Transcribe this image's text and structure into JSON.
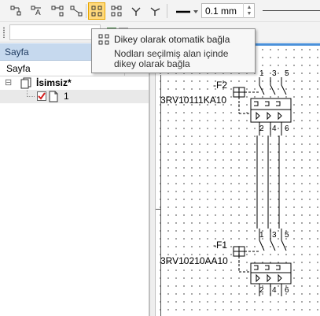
{
  "toolbar": {
    "line_width_value": "0.1 mm",
    "buttons": [
      "connect-icon",
      "text-connect-icon",
      "horizontal-connect-icon",
      "diagonal-connect-icon",
      "vertical-auto-connect-icon",
      "grid-connect-icon",
      "branch-icon",
      "branch-right-icon",
      "line-style-icon"
    ]
  },
  "tooltip": {
    "title": "Dikey olarak otomatik bağla",
    "description": "Nodları seçilmiş alan içinde dikey olarak bağla"
  },
  "left_pane": {
    "title": "Sayfa",
    "column_header": "Sayfa",
    "tree": [
      {
        "label": "İsimsiz*",
        "expand": "⊟"
      },
      {
        "label": "1"
      }
    ]
  },
  "schematic": {
    "component1": {
      "tag": "-F2",
      "part": "3RV10111KA10",
      "top_pins": [
        "1",
        "3",
        "5"
      ],
      "bottom_pins": [
        "2",
        "4",
        "6"
      ]
    },
    "component2": {
      "tag": "-F1",
      "part": "3RV10210AA10",
      "top_pins": [
        "1",
        "3",
        "5"
      ],
      "bottom_pins": [
        "2",
        "4",
        "6"
      ]
    }
  },
  "colors": {
    "accent": "#4a90d9",
    "active_button": "#ffd97a",
    "pane_title_bg": "#c6d9ee"
  }
}
